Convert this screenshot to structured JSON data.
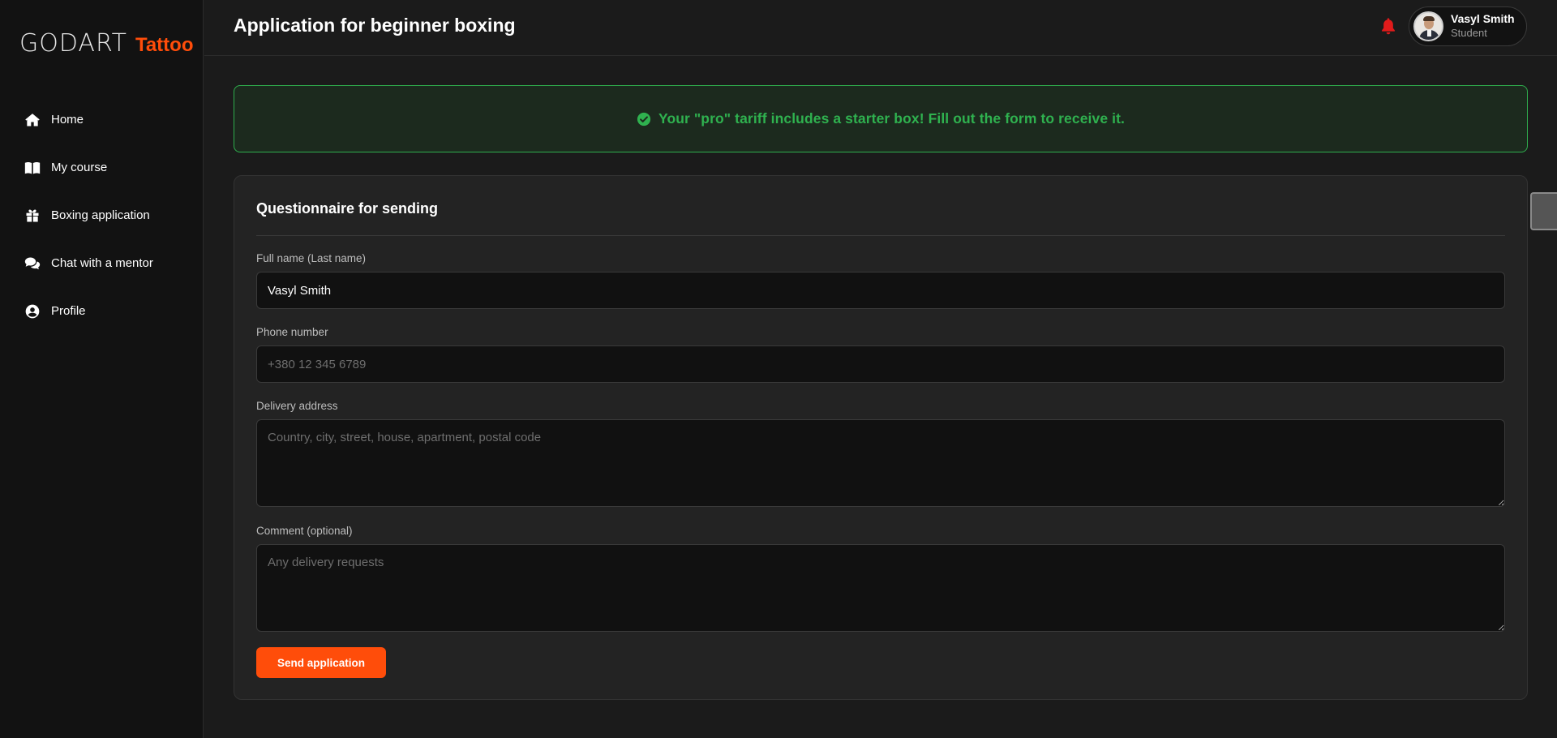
{
  "brand": {
    "name": "GODART",
    "accent": "Tattoo",
    "accent_color": "#ff4d0a"
  },
  "sidebar": {
    "items": [
      {
        "label": "Home",
        "icon": "home-icon"
      },
      {
        "label": "My course",
        "icon": "book-icon"
      },
      {
        "label": "Boxing application",
        "icon": "gift-box-icon"
      },
      {
        "label": "Chat with a mentor",
        "icon": "chat-bubbles-icon"
      },
      {
        "label": "Profile",
        "icon": "user-circle-icon"
      }
    ]
  },
  "header": {
    "title": "Application for beginner boxing",
    "notification_icon": "bell-icon",
    "user": {
      "name": "Vasyl Smith",
      "role": "Student"
    }
  },
  "alert": {
    "icon": "check-circle-icon",
    "text": "Your \"pro\" tariff includes a starter box! Fill out the form to receive it.",
    "color": "#2fb14f"
  },
  "form": {
    "title": "Questionnaire for sending",
    "full_name": {
      "label": "Full name (Last name)",
      "value": "Vasyl Smith"
    },
    "phone": {
      "label": "Phone number",
      "placeholder": "+380 12 345 6789"
    },
    "address": {
      "label": "Delivery address",
      "placeholder": "Country, city, street, house, apartment, postal code"
    },
    "comment": {
      "label": "Comment (optional)",
      "placeholder": "Any delivery requests"
    },
    "submit_label": "Send application"
  }
}
